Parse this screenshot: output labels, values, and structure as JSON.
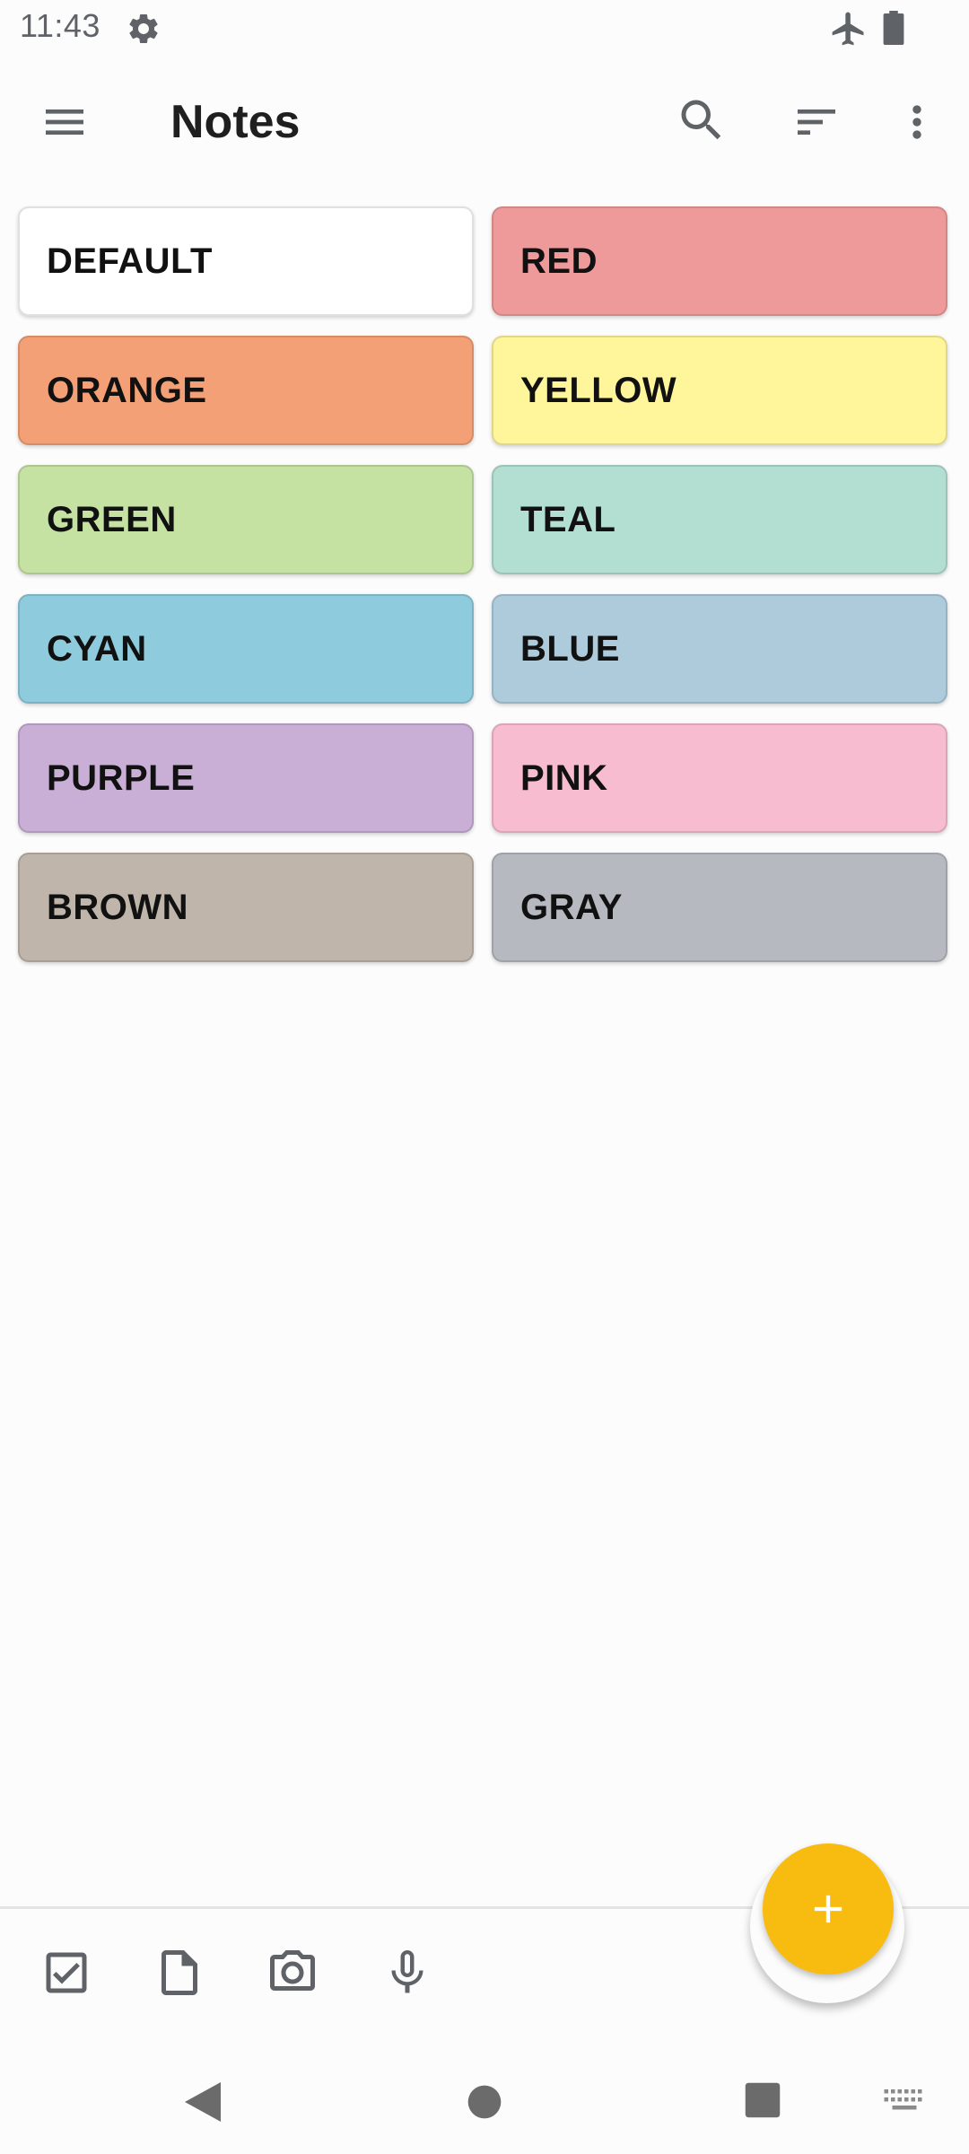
{
  "status_bar": {
    "time": "11:43",
    "icons": [
      "gear-icon",
      "airplane-icon",
      "battery-icon"
    ]
  },
  "toolbar": {
    "title": "Notes",
    "icons": [
      "menu-icon",
      "search-icon",
      "sort-icon",
      "more-vert-icon"
    ]
  },
  "colors": [
    {
      "label": "DEFAULT",
      "color": "#ffffff"
    },
    {
      "label": "RED",
      "color": "#ef9a9a"
    },
    {
      "label": "ORANGE",
      "color": "#f3a076"
    },
    {
      "label": "YELLOW",
      "color": "#fff59b"
    },
    {
      "label": "GREEN",
      "color": "#c5e2a3"
    },
    {
      "label": "TEAL",
      "color": "#b3dfd3"
    },
    {
      "label": "CYAN",
      "color": "#8ecbdc"
    },
    {
      "label": "BLUE",
      "color": "#aecbdc"
    },
    {
      "label": "PURPLE",
      "color": "#c9aed5"
    },
    {
      "label": "PINK",
      "color": "#f8bcd1"
    },
    {
      "label": "BROWN",
      "color": "#bfb5aa"
    },
    {
      "label": "GRAY",
      "color": "#b6b9c0"
    }
  ],
  "bottom_bar": {
    "icons": [
      "checklist-icon",
      "note-icon",
      "camera-icon",
      "mic-icon"
    ],
    "fab_icon": "add-icon",
    "fab_color": "#f8bb0f"
  },
  "nav_bar": {
    "icons": [
      "back-icon",
      "home-icon",
      "recents-icon",
      "keyboard-icon"
    ]
  }
}
